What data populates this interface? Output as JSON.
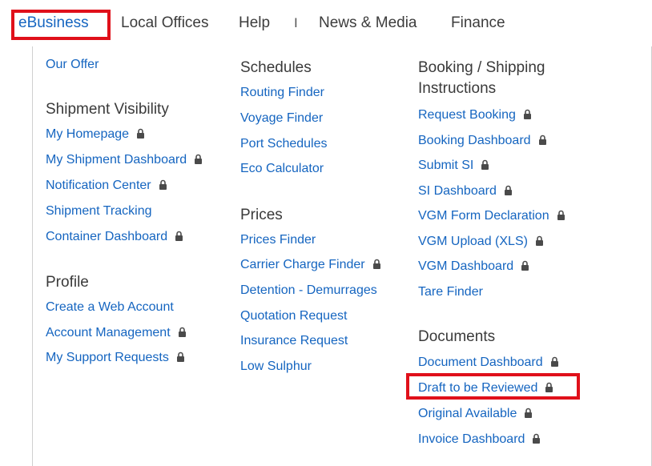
{
  "nav": {
    "ebusiness": "eBusiness",
    "local_offices": "Local Offices",
    "help": "Help",
    "separator": "I",
    "news_media": "News & Media",
    "finance": "Finance"
  },
  "menu": {
    "col1": {
      "our_offer": "Our Offer",
      "shipment_visibility": {
        "heading": "Shipment Visibility",
        "items": [
          {
            "label": "My Homepage",
            "locked": true
          },
          {
            "label": "My Shipment Dashboard",
            "locked": true
          },
          {
            "label": "Notification Center",
            "locked": true
          },
          {
            "label": "Shipment Tracking",
            "locked": false
          },
          {
            "label": "Container Dashboard",
            "locked": true
          }
        ]
      },
      "profile": {
        "heading": "Profile",
        "items": [
          {
            "label": "Create a Web Account",
            "locked": false
          },
          {
            "label": "Account Management",
            "locked": true
          },
          {
            "label": "My Support Requests",
            "locked": true
          }
        ]
      }
    },
    "col2": {
      "schedules": {
        "heading": "Schedules",
        "items": [
          {
            "label": "Routing Finder",
            "locked": false
          },
          {
            "label": "Voyage Finder",
            "locked": false
          },
          {
            "label": "Port Schedules",
            "locked": false
          },
          {
            "label": "Eco Calculator",
            "locked": false
          }
        ]
      },
      "prices": {
        "heading": "Prices",
        "items": [
          {
            "label": "Prices Finder",
            "locked": false
          },
          {
            "label": "Carrier Charge Finder",
            "locked": true
          },
          {
            "label": "Detention - Demurrages",
            "locked": false
          },
          {
            "label": "Quotation Request",
            "locked": false
          },
          {
            "label": "Insurance Request",
            "locked": false
          },
          {
            "label": "Low Sulphur",
            "locked": false
          }
        ]
      }
    },
    "col3": {
      "booking": {
        "heading_line1": "Booking / Shipping",
        "heading_line2": "Instructions",
        "items": [
          {
            "label": "Request Booking",
            "locked": true
          },
          {
            "label": "Booking Dashboard",
            "locked": true
          },
          {
            "label": "Submit SI",
            "locked": true
          },
          {
            "label": "SI Dashboard",
            "locked": true
          },
          {
            "label": "VGM Form Declaration",
            "locked": true
          },
          {
            "label": "VGM Upload (XLS)",
            "locked": true
          },
          {
            "label": "VGM Dashboard",
            "locked": true
          },
          {
            "label": "Tare Finder",
            "locked": false
          }
        ]
      },
      "documents": {
        "heading": "Documents",
        "items": [
          {
            "label": "Document Dashboard",
            "locked": true
          },
          {
            "label": "Draft to be Reviewed",
            "locked": true
          },
          {
            "label": "Original Available",
            "locked": true
          },
          {
            "label": "Invoice Dashboard",
            "locked": true
          }
        ]
      }
    }
  },
  "colors": {
    "link": "#1565c0",
    "heading": "#3a3a3a",
    "highlight": "#e0101a",
    "lock": "#4a4a4a"
  }
}
